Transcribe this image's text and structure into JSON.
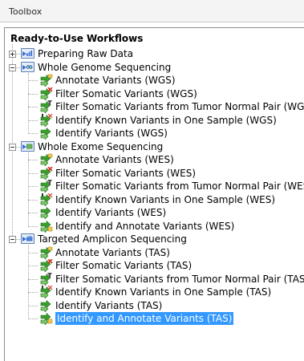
{
  "panel": {
    "title": "Toolbox"
  },
  "tree": {
    "root": "Ready-to-Use Workflows",
    "groups": [
      {
        "label": "Preparing Raw Data",
        "expanded": false,
        "items": []
      },
      {
        "label": "Whole Genome Sequencing",
        "expanded": true,
        "items": [
          {
            "label": "Annotate Variants (WGS)",
            "icon": "annotate-variants-icon"
          },
          {
            "label": "Filter Somatic Variants (WGS)",
            "icon": "filter-somatic-variants-icon"
          },
          {
            "label": "Filter Somatic Variants from Tumor Normal Pair (WGS)",
            "icon": "filter-tumor-normal-pair-icon"
          },
          {
            "label": "Identify Known Variants in One Sample (WGS)",
            "icon": "identify-known-variants-icon"
          },
          {
            "label": "Identify Variants (WGS)",
            "icon": "identify-variants-icon"
          }
        ]
      },
      {
        "label": "Whole Exome Sequencing",
        "expanded": true,
        "items": [
          {
            "label": "Annotate Variants (WES)",
            "icon": "annotate-variants-icon"
          },
          {
            "label": "Filter Somatic Variants (WES)",
            "icon": "filter-somatic-variants-icon"
          },
          {
            "label": "Filter Somatic Variants from Tumor Normal Pair (WES)",
            "icon": "filter-tumor-normal-pair-icon"
          },
          {
            "label": "Identify Known Variants in One Sample (WES)",
            "icon": "identify-known-variants-icon"
          },
          {
            "label": "Identify Variants (WES)",
            "icon": "identify-variants-icon"
          },
          {
            "label": "Identify and Annotate Variants (WES)",
            "icon": "identify-annotate-variants-icon"
          }
        ]
      },
      {
        "label": "Targeted Amplicon Sequencing",
        "expanded": true,
        "items": [
          {
            "label": "Annotate Variants (TAS)",
            "icon": "annotate-variants-icon"
          },
          {
            "label": "Filter Somatic Variants (TAS)",
            "icon": "filter-somatic-variants-icon"
          },
          {
            "label": "Filter Somatic Variants from Tumor Normal Pair (TAS)",
            "icon": "filter-tumor-normal-pair-icon"
          },
          {
            "label": "Identify Known Variants in One Sample (TAS)",
            "icon": "identify-known-variants-icon"
          },
          {
            "label": "Identify Variants (TAS)",
            "icon": "identify-variants-icon"
          },
          {
            "label": "Identify and Annotate Variants (TAS)",
            "icon": "identify-annotate-variants-icon",
            "selected": true
          }
        ]
      }
    ]
  },
  "colors": {
    "selection": "#3399ff",
    "workflow_green": "#3aa02c",
    "workflow_red": "#d43a2a",
    "category_blue": "#3a6fd8"
  }
}
